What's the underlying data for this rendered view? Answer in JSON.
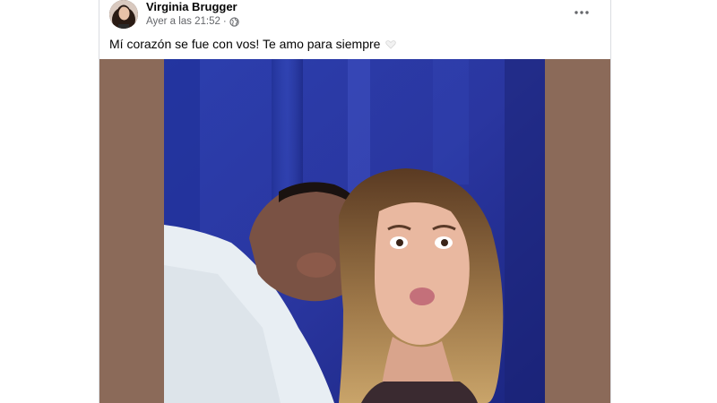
{
  "post": {
    "author": "Virginia Brugger",
    "timestamp": "Ayer a las 21:52",
    "privacy_icon": "globe-icon",
    "text": "Mí corazón se fue con vos! Te amo para siempre",
    "text_emoji_icon": "white-heart-icon",
    "more_icon": "more-options-icon"
  },
  "colors": {
    "photo_background": "#8b6a59",
    "name_text": "#050505",
    "meta_text": "#65676b"
  }
}
